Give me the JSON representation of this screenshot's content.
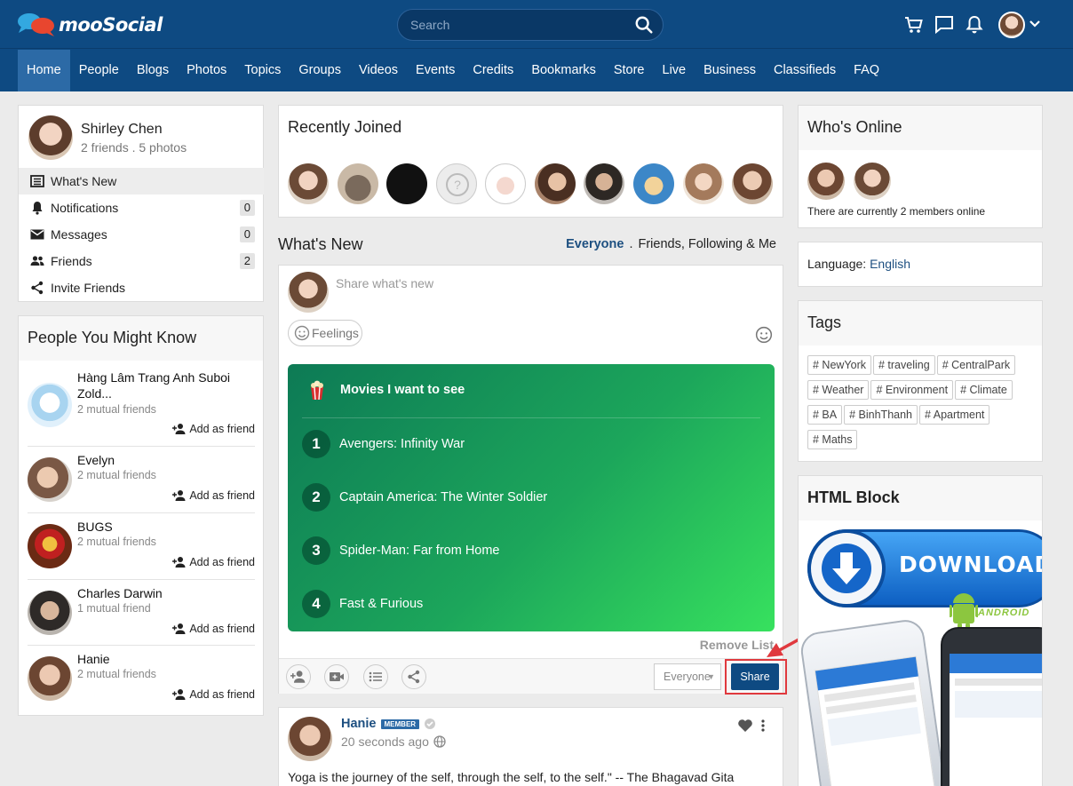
{
  "header": {
    "logo_text": "mooSocial",
    "search_placeholder": "Search"
  },
  "nav": [
    "Home",
    "People",
    "Blogs",
    "Photos",
    "Topics",
    "Groups",
    "Videos",
    "Events",
    "Credits",
    "Bookmarks",
    "Store",
    "Live",
    "Business",
    "Classifieds",
    "FAQ"
  ],
  "profile": {
    "name": "Shirley Chen",
    "stats": "2 friends . 5 photos"
  },
  "menu": [
    {
      "label": "What's New",
      "icon": "newspaper-icon",
      "count": ""
    },
    {
      "label": "Notifications",
      "icon": "bell-icon",
      "count": "0"
    },
    {
      "label": "Messages",
      "icon": "envelope-icon",
      "count": "0"
    },
    {
      "label": "Friends",
      "icon": "people-icon",
      "count": "2"
    },
    {
      "label": "Invite Friends",
      "icon": "share-icon",
      "count": ""
    }
  ],
  "pymk": {
    "title": "People You Might Know",
    "add_label": "Add as friend",
    "people": [
      {
        "name": "Hàng Lâm Trang Anh Suboi Zold...",
        "mutual": "2 mutual friends"
      },
      {
        "name": "Evelyn",
        "mutual": "2 mutual friends"
      },
      {
        "name": "BUGS",
        "mutual": "2 mutual friends"
      },
      {
        "name": "Charles Darwin",
        "mutual": "1 mutual friend"
      },
      {
        "name": "Hanie",
        "mutual": "2 mutual friends"
      }
    ]
  },
  "recently_joined": {
    "title": "Recently Joined"
  },
  "whats_new": {
    "title": "What's New",
    "filter_active": "Everyone",
    "filter_sep": ".",
    "filter_other": "Friends, Following & Me"
  },
  "composer": {
    "placeholder": "Share what's new",
    "feelings_label": "Feelings",
    "list_title": "Movies I want to see",
    "list_items": [
      {
        "num": "1",
        "text": "Avengers: Infinity War"
      },
      {
        "num": "2",
        "text": "Captain America: The Winter Soldier"
      },
      {
        "num": "3",
        "text": "Spider-Man: Far from Home"
      },
      {
        "num": "4",
        "text": "Fast & Furious"
      }
    ],
    "remove_list": "Remove List",
    "privacy": "Everyone",
    "share_label": "Share"
  },
  "post": {
    "author": "Hanie",
    "badge": "MEMBER",
    "time": "20 seconds ago",
    "text": "Yoga is the journey of the self, through the self, to the self.\" -- The Bhagavad Gita"
  },
  "whos_online": {
    "title": "Who's Online",
    "text": "There are currently 2 members online"
  },
  "language": {
    "label": "Language:",
    "value": "English"
  },
  "tags": {
    "title": "Tags",
    "items": [
      "# NewYork",
      "# traveling",
      "# CentralPark",
      "# Weather",
      "# Environment",
      "# Climate",
      "# BA",
      "# BinhThanh",
      "# Apartment",
      "# Maths"
    ]
  },
  "html_block": {
    "title": "HTML Block",
    "download_text": "DOWNLOAD",
    "android_text": "ANDROID"
  },
  "colors": {
    "header_bg": "#0e4a82",
    "nav_active": "#2c6aa6",
    "link": "#1d4f80",
    "share_btn": "#0e4a82",
    "highlight": "#e0393e"
  }
}
